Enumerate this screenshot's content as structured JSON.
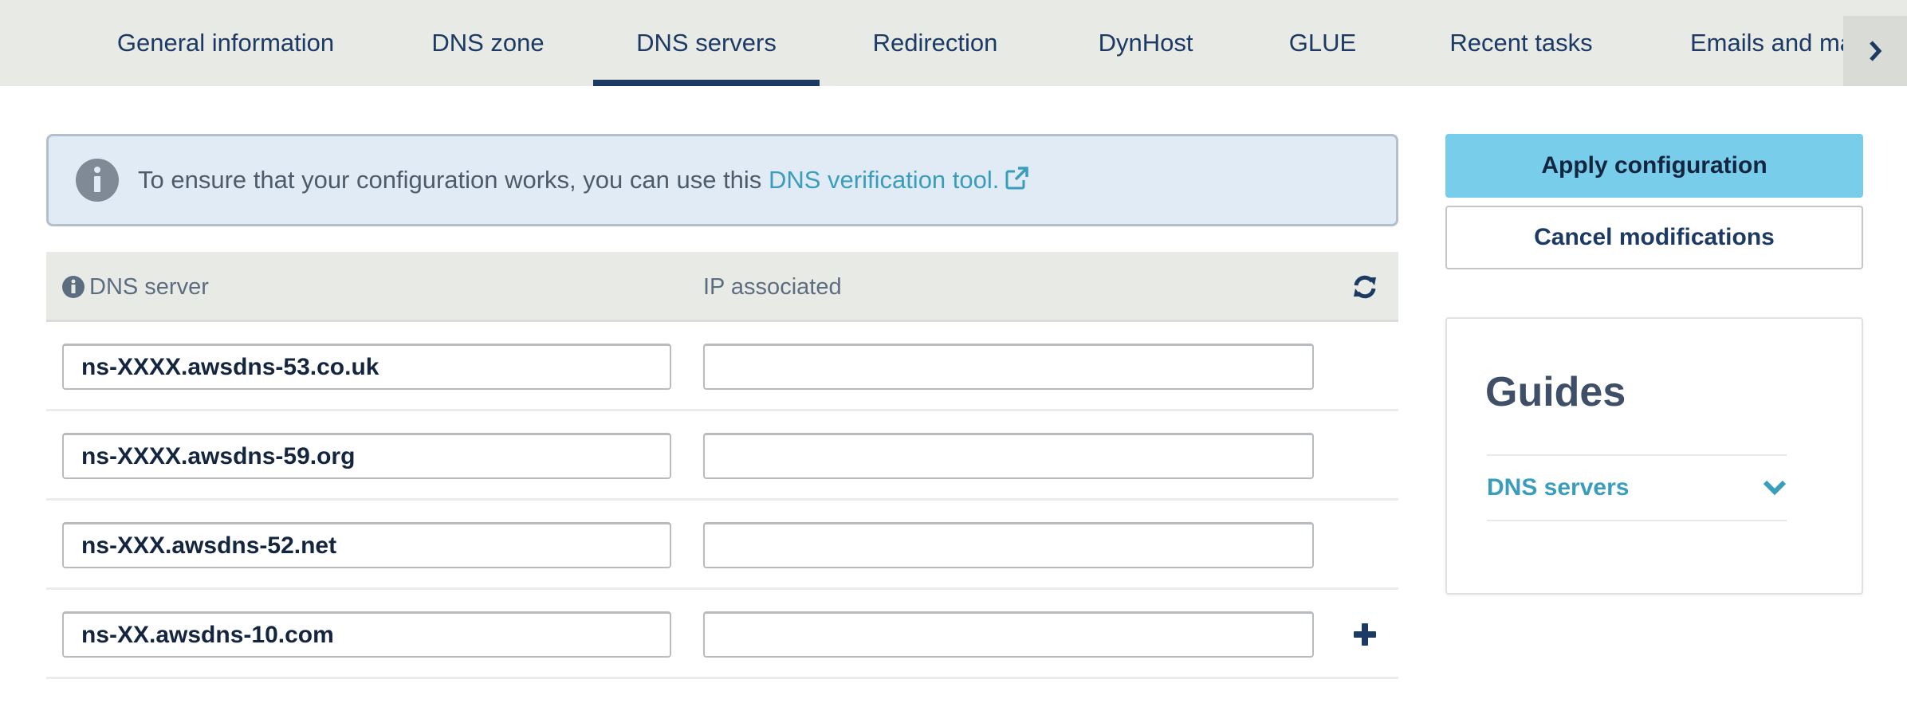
{
  "tabs": [
    {
      "label": "General information",
      "active": false
    },
    {
      "label": "DNS zone",
      "active": false
    },
    {
      "label": "DNS servers",
      "active": true
    },
    {
      "label": "Redirection",
      "active": false
    },
    {
      "label": "DynHost",
      "active": false
    },
    {
      "label": "GLUE",
      "active": false
    },
    {
      "label": "Recent tasks",
      "active": false
    },
    {
      "label": "Emails and mailing lists",
      "active": false
    }
  ],
  "tabs_next_icon": "chevron-right-icon",
  "banner": {
    "icon": "info-circle-icon",
    "text": "To ensure that your configuration works, you can use this ",
    "link_text": "DNS verification tool.",
    "link_icon": "external-link-icon"
  },
  "table": {
    "headers": {
      "dns_server": "DNS server",
      "ip_associated": "IP associated"
    },
    "header_icons": {
      "dns_server": "info-circle-icon",
      "refresh": "refresh-icon"
    },
    "rows": [
      {
        "dns_server": "ns-XXXX.awsdns-53.co.uk",
        "ip": ""
      },
      {
        "dns_server": "ns-XXXX.awsdns-59.org",
        "ip": ""
      },
      {
        "dns_server": "ns-XXX.awsdns-52.net",
        "ip": ""
      },
      {
        "dns_server": "ns-XX.awsdns-10.com",
        "ip": ""
      }
    ],
    "add_icon": "plus-icon"
  },
  "actions": {
    "apply_label": "Apply configuration",
    "cancel_label": "Cancel modifications"
  },
  "guides": {
    "title": "Guides",
    "items": [
      {
        "label": "DNS servers",
        "icon": "chevron-down-icon"
      }
    ]
  },
  "colors": {
    "primary": "#1c3a63",
    "accent": "#78cdea",
    "link": "#3a9dbb",
    "tabbar_bg": "#e8eae6",
    "banner_bg": "#e1ebf6"
  }
}
